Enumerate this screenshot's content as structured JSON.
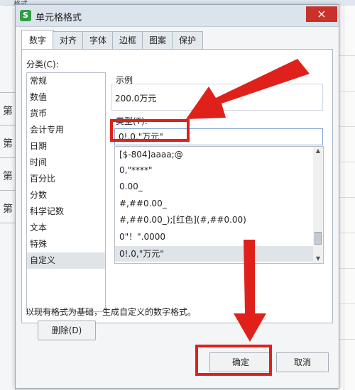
{
  "background": {
    "menu_text": "… 格式",
    "row_glyphs": [
      "第",
      "第",
      "第",
      "第"
    ]
  },
  "dialog": {
    "title": "单元格格式",
    "app_icon_letter": "S",
    "close_glyph": "×",
    "tabs": [
      "数字",
      "对齐",
      "字体",
      "边框",
      "图案",
      "保护"
    ],
    "active_tab": "数字"
  },
  "category": {
    "label": "分类(C):",
    "items": [
      "常规",
      "数值",
      "货币",
      "会计专用",
      "日期",
      "时间",
      "百分比",
      "分数",
      "科学记数",
      "文本",
      "特殊",
      "自定义"
    ],
    "selected": "自定义"
  },
  "sample": {
    "label": "示例",
    "value": "200.0万元"
  },
  "type": {
    "label": "类型(T):",
    "input_value": "0!.0,\"万元\"",
    "list": [
      "[$-804]aaaa;@",
      "0,\"****\"",
      "0.00_",
      "#,##0.00_",
      "#,##0.00_);[红色](#,##0.00)",
      "0\"！\".0000",
      "0!.0,\"万元\""
    ],
    "selected": "0!.0,\"万元\""
  },
  "buttons": {
    "delete": "删除(D)",
    "ok": "确定",
    "cancel": "取消"
  },
  "description": "以现有格式为基础，生成自定义的数字格式。",
  "colors": {
    "annotation_red": "#e0201b",
    "close_red": "#c9322b",
    "wps_green": "#2f9e45"
  }
}
